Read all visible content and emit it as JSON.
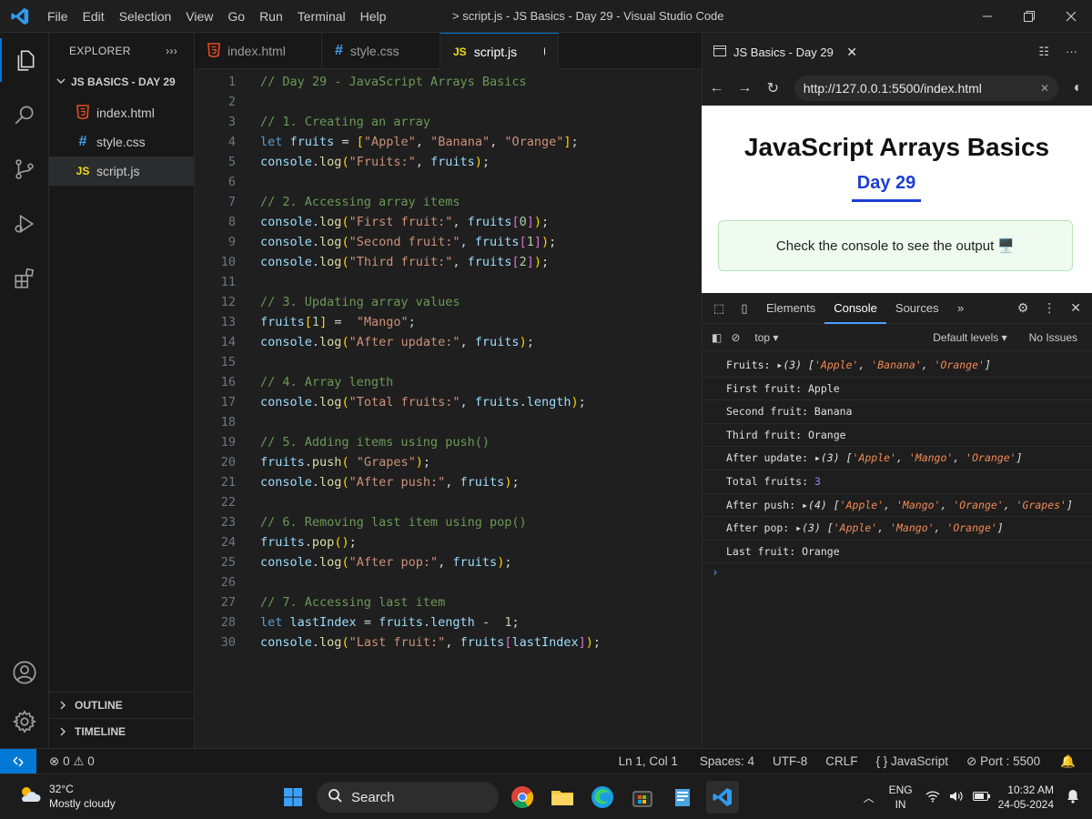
{
  "titlebar": {
    "menu": [
      "File",
      "Edit",
      "Selection",
      "View",
      "Go",
      "Run",
      "Terminal",
      "Help"
    ],
    "window_title": "> script.js - JS Basics - Day 29 - Visual Studio Code"
  },
  "sidebar": {
    "header": "EXPLORER",
    "folder": "JS BASICS - DAY 29",
    "files": [
      {
        "name": "index.html",
        "icon": "html-file-icon"
      },
      {
        "name": "style.css",
        "icon": "css-file-icon"
      },
      {
        "name": "script.js",
        "icon": "js-file-icon"
      }
    ],
    "outline": "OUTLINE",
    "timeline": "TIMELINE"
  },
  "tabs": [
    {
      "label": "index.html",
      "icon_glyph": "5"
    },
    {
      "label": "style.css",
      "icon_glyph": "#"
    },
    {
      "label": "script.js",
      "icon_glyph": "JS"
    }
  ],
  "editor": {
    "line_numbers": [
      "1",
      "2",
      "3",
      "4",
      "5",
      "6",
      "7",
      "8",
      "9",
      "10",
      "11",
      "12",
      "13",
      "14",
      "15",
      "16",
      "17",
      "18",
      "19",
      "20",
      "21",
      "22",
      "23",
      "24",
      "25",
      "26",
      "27",
      "28",
      "30"
    ],
    "comments": {
      "l1": "// Day 29 - JavaScript Arrays Basics",
      "l3": "// 1. Creating an array",
      "l7": "// 2. Accessing array items",
      "l12": "// 3. Updating array values",
      "l16": "// 4. Array length",
      "l19": "// 5. Adding items using push()",
      "l23": "// 6. Removing last item using pop()",
      "l27": "// 7. Accessing last item"
    }
  },
  "browser": {
    "tab_title": "JS Basics - Day 29",
    "url": "http://127.0.0.1:5500/index.html",
    "page": {
      "heading": "JavaScript Arrays Basics",
      "subheading": "Day 29",
      "message": "Check the console to see the output 🖥️"
    }
  },
  "devtools": {
    "tabs": [
      "Elements",
      "Console",
      "Sources"
    ],
    "context": "top",
    "levels": "Default levels",
    "issues": "No Issues"
  },
  "console_output": [
    {
      "label": "Fruits: ",
      "count": "(3)",
      "items": [
        "'Apple'",
        "'Banana'",
        "'Orange'"
      ]
    },
    {
      "label": "First fruit: Apple"
    },
    {
      "label": "Second fruit: Banana"
    },
    {
      "label": "Third fruit: Orange"
    },
    {
      "label": "After update: ",
      "count": "(3)",
      "items": [
        "'Apple'",
        "'Mango'",
        "'Orange'"
      ]
    },
    {
      "label": "Total fruits: ",
      "number": "3"
    },
    {
      "label": "After push: ",
      "count": "(4)",
      "items": [
        "'Apple'",
        "'Mango'",
        "'Orange'",
        "'Grapes'"
      ]
    },
    {
      "label": "After pop: ",
      "count": "(3)",
      "items": [
        "'Apple'",
        "'Mango'",
        "'Orange'"
      ]
    },
    {
      "label": "Last fruit: Orange"
    }
  ],
  "statusbar": {
    "problems": "0",
    "warnings": "0",
    "position": "Ln 1, Col 1",
    "spaces": "Spaces: 4",
    "encoding": "UTF-8",
    "eol": "CRLF",
    "language": "JavaScript",
    "port": "Port : 5500"
  },
  "taskbar": {
    "temperature": "32°C",
    "weather": "Mostly cloudy",
    "search": "Search",
    "lang1": "ENG",
    "lang2": "IN",
    "time": "10:32 AM",
    "date": "24-05-2024"
  },
  "colors": {
    "accent": "#0078d4",
    "editor_bg": "#1f1f1f",
    "comment": "#6a9955",
    "string": "#ce9178",
    "keyword": "#569cd6"
  }
}
